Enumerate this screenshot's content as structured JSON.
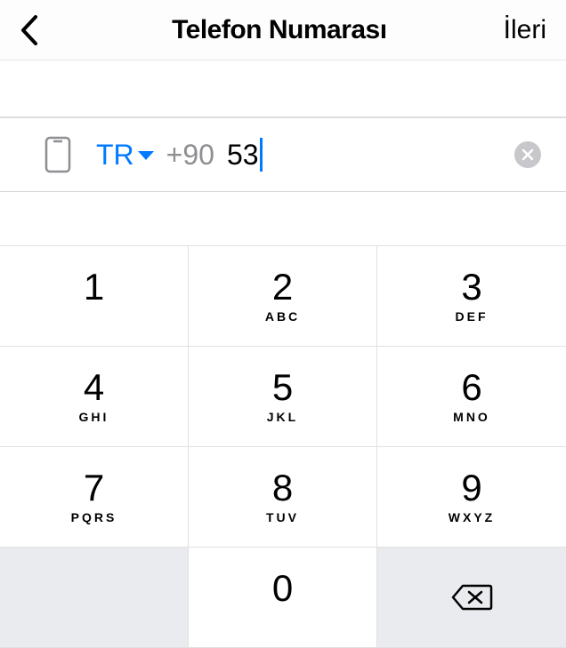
{
  "header": {
    "title": "Telefon Numarası",
    "next": "İleri"
  },
  "input": {
    "country": "TR",
    "calling_code": "+90",
    "entered": "53"
  },
  "keypad": {
    "keys": [
      {
        "digit": "1",
        "letters": ""
      },
      {
        "digit": "2",
        "letters": "ABC"
      },
      {
        "digit": "3",
        "letters": "DEF"
      },
      {
        "digit": "4",
        "letters": "GHI"
      },
      {
        "digit": "5",
        "letters": "JKL"
      },
      {
        "digit": "6",
        "letters": "MNO"
      },
      {
        "digit": "7",
        "letters": "PQRS"
      },
      {
        "digit": "8",
        "letters": "TUV"
      },
      {
        "digit": "9",
        "letters": "WXYZ"
      },
      {
        "digit": "0",
        "letters": ""
      }
    ]
  }
}
